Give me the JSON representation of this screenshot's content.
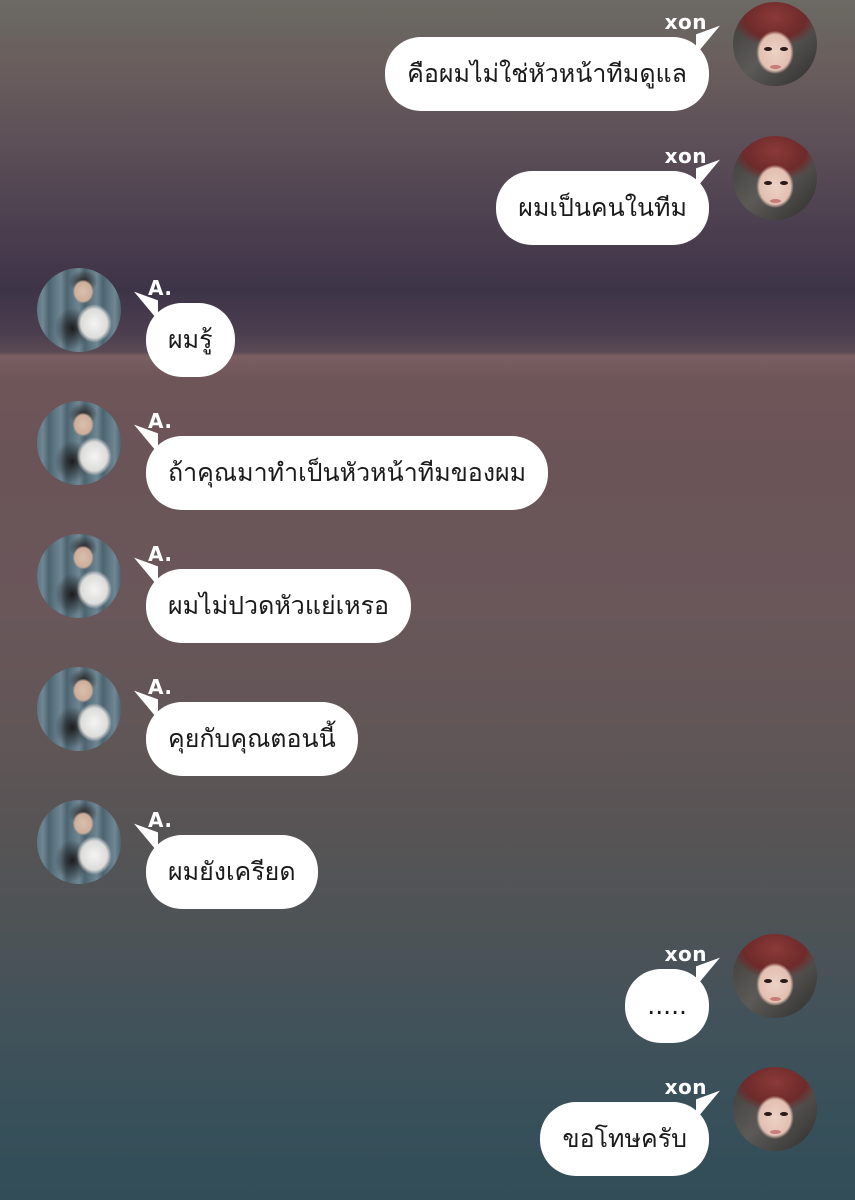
{
  "messages": [
    {
      "sender": "xon",
      "side": "right",
      "avatar_icon": "xon-avatar",
      "text": "คือผมไม่ใช่หัวหน้าทีมดูแล"
    },
    {
      "sender": "xon",
      "side": "right",
      "avatar_icon": "xon-avatar",
      "text": "ผมเป็นคนในทีม"
    },
    {
      "sender": "A.",
      "side": "left",
      "avatar_icon": "a-avatar",
      "text": "ผมรู้"
    },
    {
      "sender": "A.",
      "side": "left",
      "avatar_icon": "a-avatar",
      "text": "ถ้าคุณมาทำเป็นหัวหน้าทีมของผม"
    },
    {
      "sender": "A.",
      "side": "left",
      "avatar_icon": "a-avatar",
      "text": "ผมไม่ปวดหัวแย่เหรอ"
    },
    {
      "sender": "A.",
      "side": "left",
      "avatar_icon": "a-avatar",
      "text": "คุยกับคุณตอนนี้"
    },
    {
      "sender": "A.",
      "side": "left",
      "avatar_icon": "a-avatar",
      "text": "ผมยังเครียด"
    },
    {
      "sender": "xon",
      "side": "right",
      "avatar_icon": "xon-avatar",
      "text": "....."
    },
    {
      "sender": "xon",
      "side": "right",
      "avatar_icon": "xon-avatar",
      "text": "ขอโทษครับ"
    }
  ],
  "colors": {
    "bubble": "#ffffff",
    "text": "#1a1a1a",
    "name": "#ffffff"
  }
}
